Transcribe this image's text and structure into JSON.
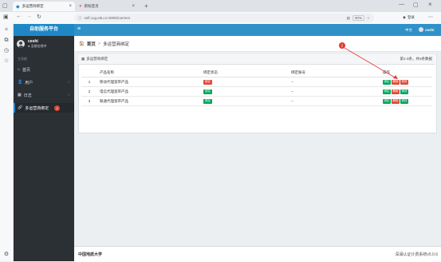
{
  "browser": {
    "tabs": [
      {
        "title": "多运营商绑定",
        "active": true
      },
      {
        "title": "新标签页",
        "active": false
      }
    ],
    "new_tab_symbol": "+",
    "url": "self.cug.edu.cn:8080/carriers",
    "zoom": "90%",
    "login_label": "登录",
    "menu_dots": "⋯"
  },
  "sidebar": {
    "title": "自助服务平台",
    "user_name": "ceshi",
    "user_status": "● 当前在线中",
    "section_label": "主导航",
    "items": [
      {
        "label": "首页",
        "icon": "home-icon",
        "has_children": false
      },
      {
        "label": "用户",
        "icon": "user-icon",
        "has_children": true
      },
      {
        "label": "日志",
        "icon": "log-icon",
        "has_children": true
      },
      {
        "label": "多运营商绑定",
        "icon": "link-icon",
        "has_children": false,
        "active": true,
        "badge": "1"
      }
    ]
  },
  "topbar": {
    "menu_icon": "≡",
    "language": "中文",
    "user": "ceshi"
  },
  "breadcrumb": {
    "home": "首页",
    "separator": ">",
    "current": "多运营商绑定"
  },
  "panel": {
    "title": "多运营商绑定",
    "count_text": "第1-3条，共3条数据",
    "columns": [
      "",
      "产品名称",
      "绑定状态",
      "绑定账号",
      "操作"
    ],
    "rows": [
      {
        "index": "1",
        "product": "移动代理宽带产品",
        "status": "绑定",
        "status_color": "#dd4b39",
        "account": "--",
        "ops": [
          "绑定",
          "解绑",
          "修改"
        ]
      },
      {
        "index": "2",
        "product": "电信代理宽带产品",
        "status": "绑定",
        "status_color": "#00a65a",
        "account": "--",
        "ops": [
          "绑定",
          "解绑",
          "修改"
        ]
      },
      {
        "index": "3",
        "product": "联通代理宽带产品",
        "status": "绑定",
        "status_color": "#00a65a",
        "account": "--",
        "ops": [
          "绑定",
          "解绑",
          "修改"
        ]
      }
    ],
    "op_colors": [
      "#00a65a",
      "#dd4b39",
      "#dd4b39"
    ]
  },
  "annotation": {
    "label": "2",
    "color": "#e53935"
  },
  "footer": {
    "left": "中国地质大学",
    "right": "深澜认证计费系统v5.0.6"
  },
  "colors": {
    "accent": "#2f91c8",
    "sidebar_bg": "#2b3035",
    "danger": "#dd4b39",
    "success": "#00a65a"
  }
}
